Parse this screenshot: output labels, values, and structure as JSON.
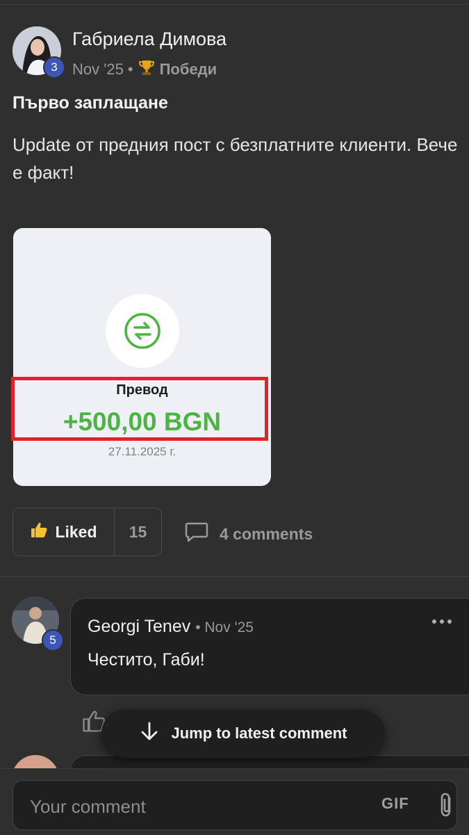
{
  "post": {
    "author": "Габриела Димова",
    "author_level": "3",
    "date": "Nov '25",
    "separator": "•",
    "category_icon": "trophy-icon",
    "category": "Победи",
    "title": "Първо заплащане",
    "body": "Update от предния пост с безплатните клиенти. Вече е факт!",
    "image": {
      "icon": "transfer-arrows-icon",
      "label": "Превод",
      "amount": "+500,00 BGN",
      "date": "27.11.2025 г."
    },
    "like_label": "Liked",
    "like_count": "15",
    "comments_label": "4 comments"
  },
  "comments": [
    {
      "author": "Georgi Tenev",
      "author_level": "5",
      "date": "• Nov '25",
      "text": "Честито, Габи!"
    }
  ],
  "jump_label": "Jump to latest comment",
  "composer": {
    "placeholder": "Your comment",
    "gif_label": "GIF"
  },
  "colors": {
    "background": "#2f2f30",
    "accent_green": "#4bb443",
    "highlight_red": "#e3222c",
    "level_badge": "#3d55b8"
  }
}
